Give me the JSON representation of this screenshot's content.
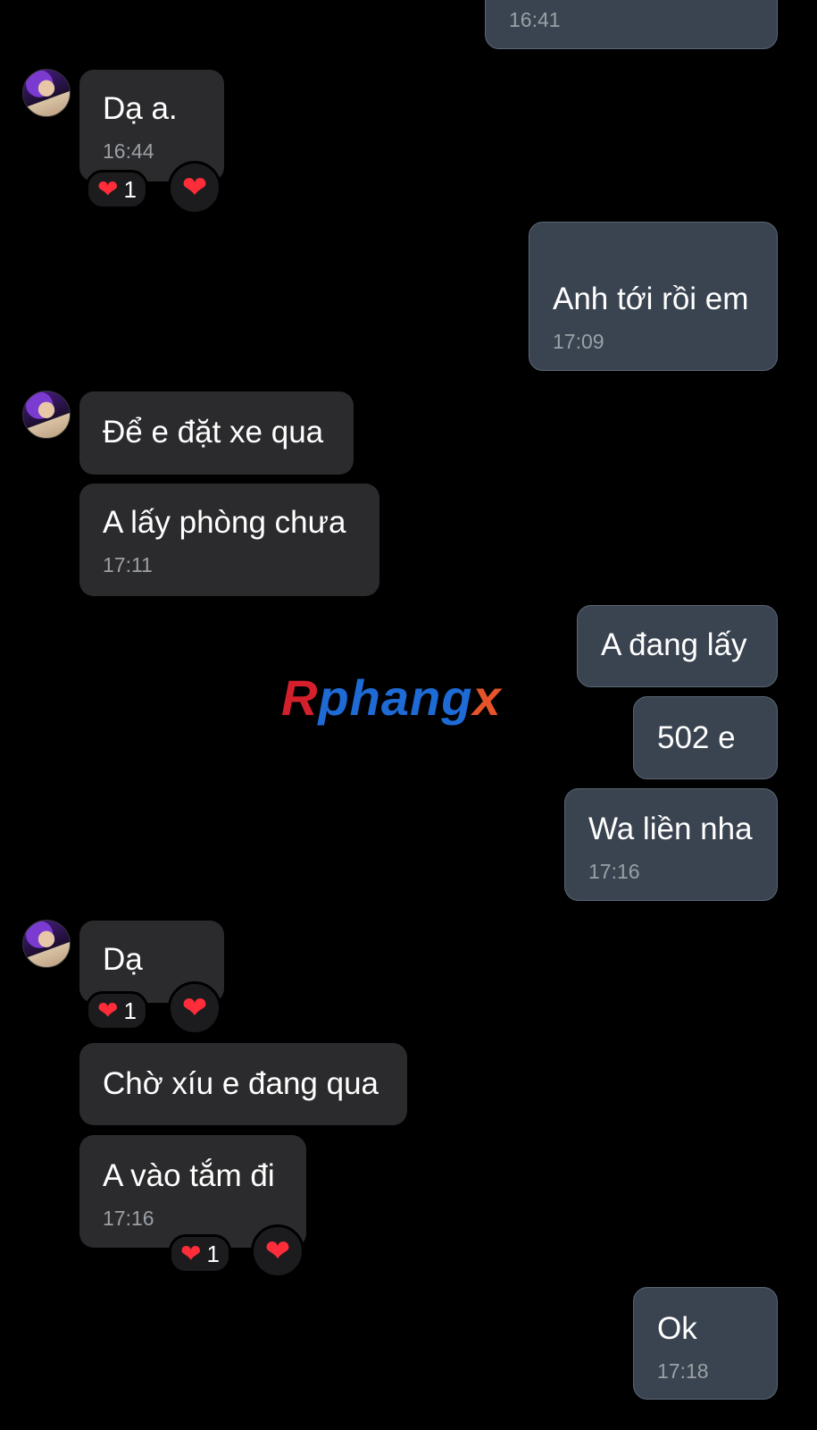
{
  "messages": [
    {
      "text": "",
      "time": "16:41"
    },
    {
      "text": "Dạ a.",
      "time": "16:44",
      "reaction_count": "1"
    },
    {
      "text": "Anh tới rồi em",
      "time": "17:09"
    },
    {
      "text": "Để e đặt xe qua"
    },
    {
      "text": "A lấy phòng chưa",
      "time": "17:11"
    },
    {
      "text": "A đang lấy"
    },
    {
      "text": "502 e"
    },
    {
      "text": "Wa liền nha",
      "time": "17:16"
    },
    {
      "text": "Dạ",
      "reaction_count": "1"
    },
    {
      "text": "Chờ xíu e đang qua"
    },
    {
      "text": "A vào tắm đi",
      "time": "17:16",
      "reaction_count": "1"
    },
    {
      "text": "Ok",
      "time": "17:18"
    }
  ],
  "reaction_icon": "heart-icon",
  "colors": {
    "heart": "#ff2d3a",
    "incoming_bubble": "#2b2b2d",
    "outgoing_bubble": "#3a4350"
  },
  "watermark": {
    "part1": "R",
    "part2": "phang",
    "part3": "x"
  }
}
